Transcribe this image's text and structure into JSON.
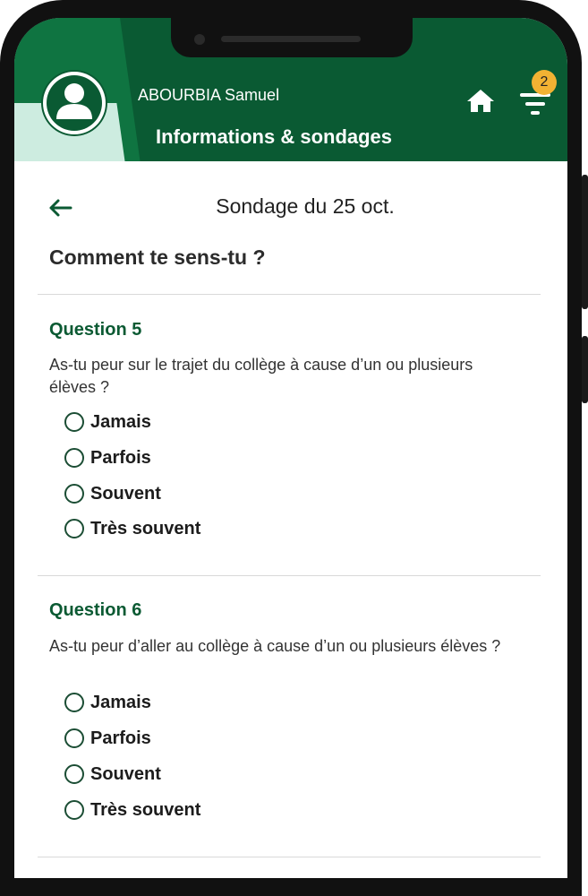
{
  "header": {
    "username": "ABOURBIA Samuel",
    "title": "Informations & sondages",
    "notification_count": "2",
    "colors": {
      "primary": "#0a5a33",
      "accent": "#f2b233",
      "mint": "#cdece0"
    }
  },
  "page": {
    "title": "Sondage du 25 oct.",
    "survey_title": "Comment te sens-tu ?"
  },
  "questions": [
    {
      "label": "Question 5",
      "text": "As-tu peur sur le trajet du collège à cause d’un ou plusieurs élèves ?",
      "options": [
        "Jamais",
        "Parfois",
        "Souvent",
        "Très souvent"
      ]
    },
    {
      "label": "Question 6",
      "text": "As-tu peur d’aller au collège à cause d’un ou plusieurs élèves ?",
      "options": [
        "Jamais",
        "Parfois",
        "Souvent",
        "Très souvent"
      ]
    }
  ],
  "icons": [
    "user-avatar-icon",
    "home-icon",
    "filter-icon",
    "back-arrow-icon"
  ]
}
